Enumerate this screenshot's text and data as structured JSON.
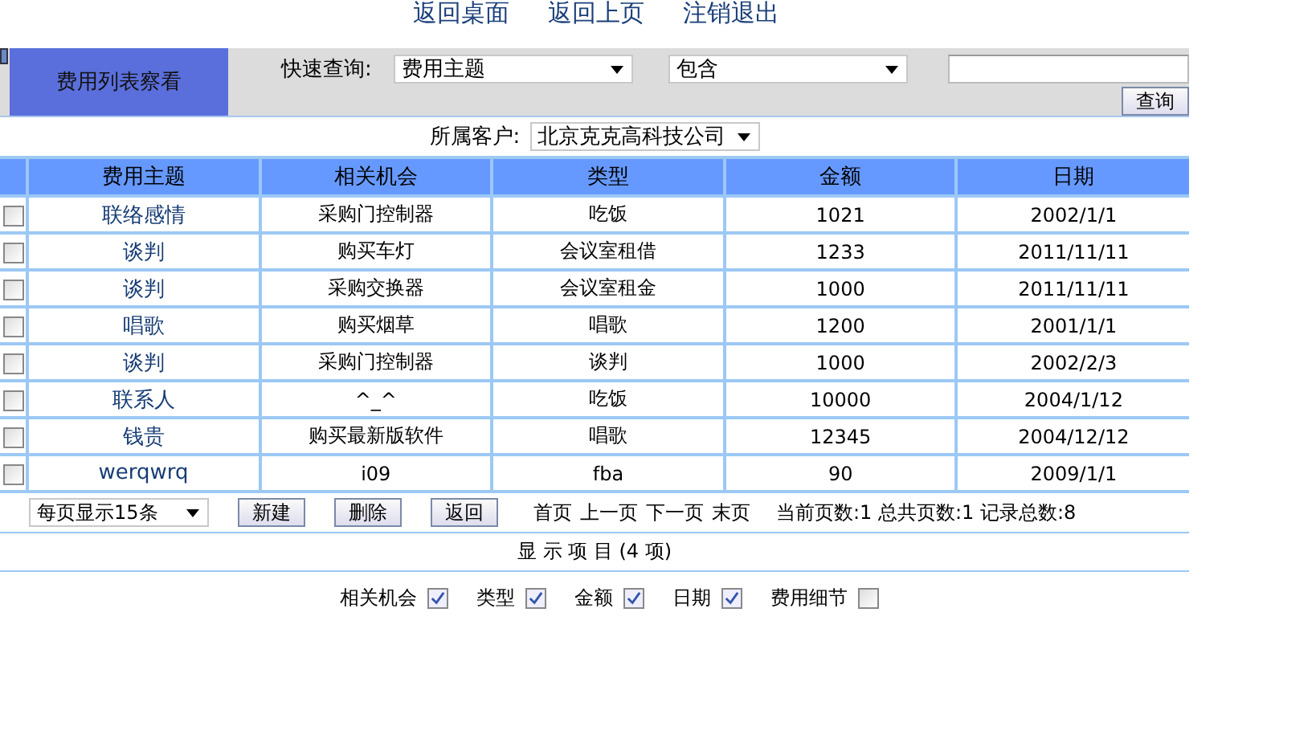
{
  "top_links": [
    "返回桌面",
    "返回上页",
    "注销退出"
  ],
  "header": {
    "title": "费用列表察看",
    "quick_search_label": "快速查询:",
    "field_select": "费用主题",
    "operator_select": "包含",
    "search_button": "查询"
  },
  "customer": {
    "label": "所属客户:",
    "value": "北京克克高科技公司"
  },
  "table": {
    "columns": [
      "费用主题",
      "相关机会",
      "类型",
      "金额",
      "日期"
    ],
    "rows": [
      {
        "checked": false,
        "cells": [
          "联络感情",
          "采购门控制器",
          "吃饭",
          "1021",
          "2002/1/1"
        ]
      },
      {
        "checked": false,
        "cells": [
          "谈判",
          "购买车灯",
          "会议室租借",
          "1233",
          "2011/11/11"
        ]
      },
      {
        "checked": false,
        "cells": [
          "谈判",
          "采购交换器",
          "会议室租金",
          "1000",
          "2011/11/11"
        ]
      },
      {
        "checked": false,
        "cells": [
          "唱歌",
          "购买烟草",
          "唱歌",
          "1200",
          "2001/1/1"
        ]
      },
      {
        "checked": false,
        "cells": [
          "谈判",
          "采购门控制器",
          "谈判",
          "1000",
          "2002/2/3"
        ]
      },
      {
        "checked": false,
        "cells": [
          "联系人",
          "^_^",
          "吃饭",
          "10000",
          "2004/1/12"
        ]
      },
      {
        "checked": false,
        "cells": [
          "钱贵",
          "购买最新版软件",
          "唱歌",
          "12345",
          "2004/12/12"
        ]
      },
      {
        "checked": false,
        "cells": [
          "werqwrq",
          "i09",
          "fba",
          "90",
          "2009/1/1"
        ]
      }
    ]
  },
  "pagination": {
    "page_size": "每页显示15条",
    "buttons": [
      "新建",
      "删除",
      "返回"
    ],
    "nav_links": [
      "首页",
      "上一页",
      "下一页",
      "末页"
    ],
    "status": "当前页数:1 总共页数:1 记录总数:8"
  },
  "display_items": {
    "title": "显 示 项 目 (4 项)",
    "items": [
      {
        "label": "相关机会",
        "checked": true
      },
      {
        "label": "类型",
        "checked": true
      },
      {
        "label": "金额",
        "checked": true
      },
      {
        "label": "日期",
        "checked": true
      },
      {
        "label": "费用细节",
        "checked": false
      }
    ]
  }
}
